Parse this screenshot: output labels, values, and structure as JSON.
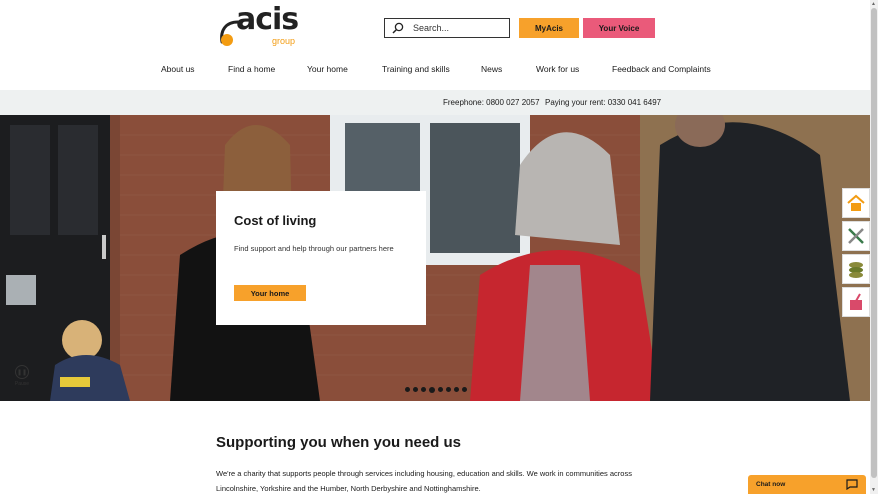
{
  "header": {
    "logo_text": "acis",
    "logo_sub": "group",
    "search": {
      "placeholder": "Search..."
    },
    "myacis_label": "MyAcis",
    "yourvoice_label": "Your Voice",
    "nav": [
      {
        "label": "About us"
      },
      {
        "label": "Find a home"
      },
      {
        "label": "Your home"
      },
      {
        "label": "Training and skills"
      },
      {
        "label": "News"
      },
      {
        "label": "Work for us"
      },
      {
        "label": "Feedback and Complaints"
      }
    ]
  },
  "infobar": {
    "freephone": "Freephone: 0800 027 2057",
    "rent": "Paying your rent: 0330 041 6497"
  },
  "hero": {
    "card_title": "Cost of living",
    "card_text": "Find support and help through our partners here",
    "card_button": "Your home",
    "pause_label": "Pause",
    "slide_count": 8,
    "active_slide": 3
  },
  "side_links": [
    {
      "icon": "house-icon"
    },
    {
      "icon": "tools-icon"
    },
    {
      "icon": "money-icon"
    },
    {
      "icon": "cleaning-icon"
    }
  ],
  "content": {
    "title": "Supporting you when you need us",
    "text": "We're a charity that supports people through services including housing, education and skills. We work in communities across Lincolnshire, Yorkshire and the Humber, North Derbyshire and Nottinghamshire."
  },
  "chat": {
    "label": "Chat now"
  },
  "colors": {
    "accent_orange": "#f7a12b",
    "accent_pink": "#ea5a7a",
    "infobar_bg": "#eef1f1"
  }
}
